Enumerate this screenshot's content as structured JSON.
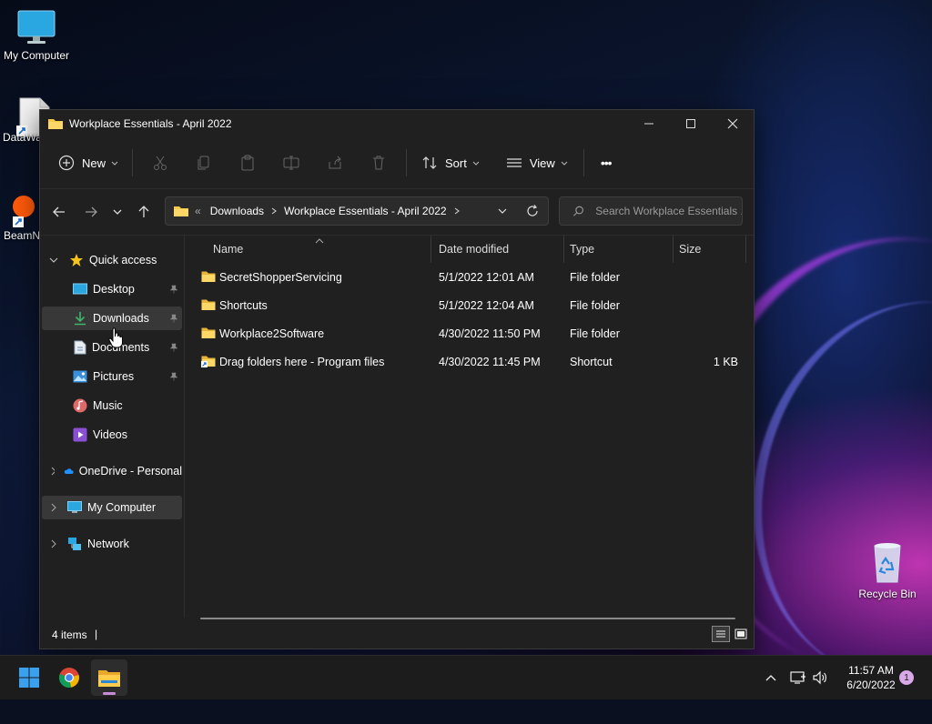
{
  "desktop": {
    "icons": [
      {
        "label": "My Computer"
      },
      {
        "label": "DataWa"
      },
      {
        "label": "BeamN"
      },
      {
        "label": "Recycle Bin"
      }
    ]
  },
  "window": {
    "title": "Workplace Essentials - April 2022",
    "controls": {
      "minimize": "minimize",
      "maximize": "maximize",
      "close": "close"
    }
  },
  "toolbar": {
    "new_label": "New",
    "sort_label": "Sort",
    "view_label": "View",
    "more_label": "•••"
  },
  "address": {
    "overflow": "«",
    "crumbs": [
      "Downloads",
      "Workplace Essentials - April 2022"
    ],
    "search_placeholder": "Search Workplace Essentials ..."
  },
  "sidebar": {
    "quick_access": "Quick access",
    "items": [
      {
        "label": "Desktop",
        "icon": "desktop-icon"
      },
      {
        "label": "Downloads",
        "icon": "download-icon"
      },
      {
        "label": "Documents",
        "icon": "document-icon"
      },
      {
        "label": "Pictures",
        "icon": "pictures-icon"
      },
      {
        "label": "Music",
        "icon": "music-icon"
      },
      {
        "label": "Videos",
        "icon": "video-icon"
      }
    ],
    "onedrive": "OneDrive - Personal",
    "my_computer": "My Computer",
    "network": "Network"
  },
  "columns": {
    "name": "Name",
    "date": "Date modified",
    "type": "Type",
    "size": "Size"
  },
  "files": [
    {
      "name": "SecretShopperServicing",
      "date": "5/1/2022 12:01 AM",
      "type": "File folder",
      "size": ""
    },
    {
      "name": "Shortcuts",
      "date": "5/1/2022 12:04 AM",
      "type": "File folder",
      "size": ""
    },
    {
      "name": "Workplace2Software",
      "date": "4/30/2022 11:50 PM",
      "type": "File folder",
      "size": ""
    },
    {
      "name": "Drag folders here - Program files",
      "date": "4/30/2022 11:45 PM",
      "type": "Shortcut",
      "size": "1 KB"
    }
  ],
  "status": {
    "items_count": "4 items",
    "caret": "|"
  },
  "taskbar": {
    "time": "11:57 AM",
    "date": "6/20/2022",
    "notification_count": "1"
  },
  "colors": {
    "accent": "#60cdff",
    "folder": "#f7c948",
    "selected": "#383838"
  }
}
